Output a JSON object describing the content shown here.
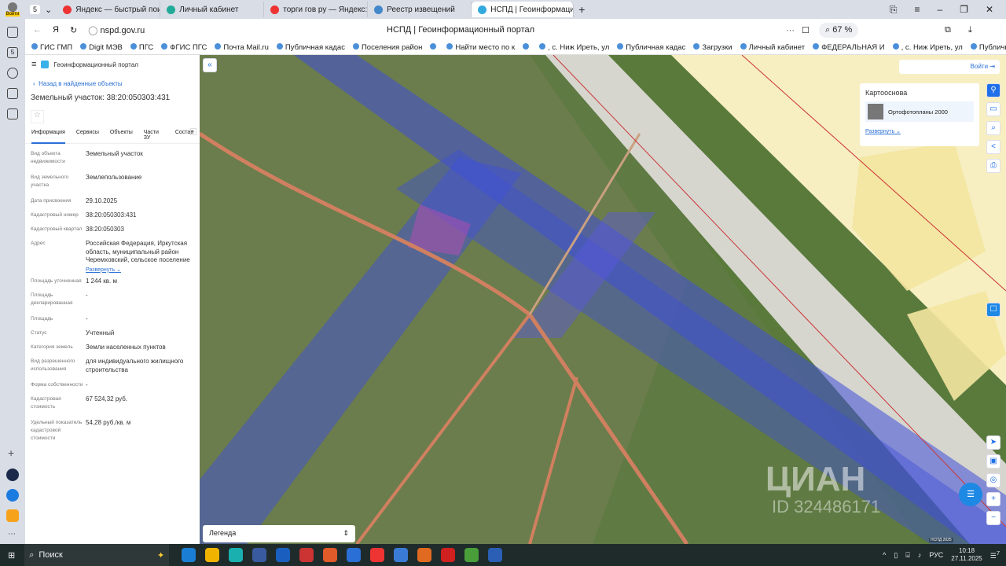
{
  "browser": {
    "profile_label": "Войти",
    "tab_count": "5",
    "tabs": [
      {
        "label": "Яндекс — быстрый поиск",
        "color": "#e33"
      },
      {
        "label": "Личный кабинет",
        "color": "#2a9"
      },
      {
        "label": "торги гов ру — Яндекс: н",
        "color": "#e33"
      },
      {
        "label": "Реестр извещений",
        "color": "#48c"
      },
      {
        "label": "НСПД | Геоинформационный портал",
        "color": "#3ad",
        "active": true
      }
    ],
    "url": "nspd.gov.ru",
    "page_title": "НСПД | Геоинформационный портал",
    "zoom": "67 %",
    "bookmarks": [
      "ГИС ГМП",
      "Digit МЭВ",
      "ПГС",
      "ФГИС ПГС",
      "Почта Mail.ru",
      "Публичная кадас",
      "Поселения район",
      "",
      "Найти место по к",
      "",
      ", с. Ниж Иреть, ул",
      "Публичная кадас",
      "Загрузки",
      "Личный кабинет",
      "ФЕДЕРАЛЬНАЯ И",
      ", с. Ниж Иреть, ул",
      "Публичная ка"
    ]
  },
  "panel": {
    "portal_name": "Геоинформационный портал",
    "back_link": "Назад в найденные объекты",
    "title": "Земельный участок: 38:20:050303:431",
    "tabs": [
      "Информация",
      "Сервисы",
      "Объекты",
      "Части ЗУ",
      "Состав"
    ],
    "fields": [
      {
        "label": "Вид объекта недвижимости",
        "value": "Земельный участок"
      },
      {
        "label": "Вид земельного участка",
        "value": "Землепользование"
      },
      {
        "label": "Дата присвоения",
        "value": "29.10.2025"
      },
      {
        "label": "Кадастровый номер",
        "value": "38:20:050303:431"
      },
      {
        "label": "Кадастровый квартал",
        "value": "38:20:050303"
      },
      {
        "label": "Адрес",
        "value": "Российская Федерация, Иркутская область, муниципальный район Черемховский, сельское поселение"
      },
      {
        "label": "Площадь уточненная",
        "value": "1 244 кв. м"
      },
      {
        "label": "Площадь декларированная",
        "value": "-"
      },
      {
        "label": "Площадь",
        "value": "-"
      },
      {
        "label": "Статус",
        "value": "Учтенный"
      },
      {
        "label": "Категория земель",
        "value": "Земли населенных пунктов"
      },
      {
        "label": "Вид разрешенного использования",
        "value": "для индивидуального жилищного строительства"
      },
      {
        "label": "Форма собственности",
        "value": "-"
      },
      {
        "label": "Кадастровая стоимость",
        "value": "67 524,32 руб."
      },
      {
        "label": "Удельный показатель кадастровой стоимости",
        "value": "54,28 руб./кв. м"
      }
    ],
    "expand": "Развернуть"
  },
  "map": {
    "login": "Войти",
    "basemap_title": "Картооснова",
    "basemap_item": "Ортофотопланы 2000",
    "expand": "Развернуть",
    "legend": "Легенда",
    "watermark": "ЦИАН",
    "watermark_id": "ID 324486171",
    "attribution": "НСПД 2025"
  },
  "taskbar": {
    "search": "Поиск",
    "lang": "РУС",
    "time": "10:18",
    "date": "27.11.2025",
    "notifications": "7"
  }
}
